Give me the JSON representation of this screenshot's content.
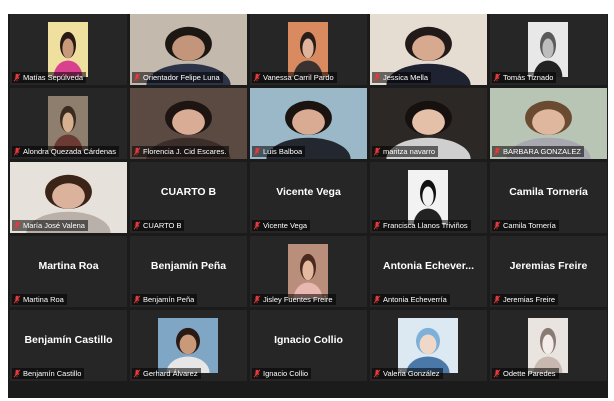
{
  "accent_active": "#d7e04a",
  "mic_muted_color": "#e5393a",
  "tiles": [
    {
      "label": "Matías Sepúlveda",
      "center": "",
      "video": "box",
      "bg": "#efe0a0",
      "skin": "#c99a7a",
      "hair": "#2a1a15",
      "shirt": "#d9418e",
      "active": false
    },
    {
      "label": "Orientador Felipe Luna",
      "center": "",
      "video": "full",
      "bg": "#c4b9ad",
      "skin": "#c3957a",
      "hair": "#1d1714",
      "shirt": "#2e3447",
      "active": false
    },
    {
      "label": "Vanessa Carril Pardo",
      "center": "",
      "video": "box",
      "bg": "#d98a5e",
      "skin": "#e0b49a",
      "hair": "#2a1c18",
      "shirt": "#3a3230",
      "active": false
    },
    {
      "label": "Jessica Mella",
      "center": "",
      "video": "full",
      "bg": "#e6ddd2",
      "skin": "#d7a98f",
      "hair": "#221a18",
      "shirt": "#1f2230",
      "active": true
    },
    {
      "label": "Tomás Tiznado",
      "center": "",
      "video": "box",
      "bg": "#e8e8e8",
      "skin": "#bdbdbd",
      "hair": "#5a5a5a",
      "shirt": "#222222",
      "active": false
    },
    {
      "label": "Alondra Quezada Cárdenas",
      "center": "",
      "video": "box",
      "bg": "#8e7e6d",
      "skin": "#d7b08f",
      "hair": "#3a2a20",
      "shirt": "#6b3a32",
      "active": false
    },
    {
      "label": "Florencia J. Cid Escares.",
      "center": "",
      "video": "full",
      "bg": "#5a4a42",
      "skin": "#d9ad95",
      "hair": "#1e1512",
      "shirt": "#3b2e2a",
      "active": false
    },
    {
      "label": "Luis Balboa",
      "center": "",
      "video": "full",
      "bg": "#9ab8c8",
      "skin": "#d8ab92",
      "hair": "#1a1310",
      "shirt": "#23272f",
      "active": false
    },
    {
      "label": "maritza navarro",
      "center": "",
      "video": "full",
      "bg": "#2c2826",
      "skin": "#e4c0a8",
      "hair": "#16110f",
      "shirt": "#cfcfcf",
      "active": false
    },
    {
      "label": "BARBARA GONZALEZ",
      "center": "",
      "video": "full",
      "bg": "#b8c4b4",
      "skin": "#dfb79e",
      "hair": "#6a4a30",
      "shirt": "#a8a8b0",
      "active": false
    },
    {
      "label": "María José Valena",
      "center": "",
      "video": "full",
      "bg": "#e7e1dc",
      "skin": "#dbb39d",
      "hair": "#3a2418",
      "shirt": "#b9b0aa",
      "active": false
    },
    {
      "label": "CUARTO B",
      "center": "CUARTO B",
      "video": "none",
      "active": false
    },
    {
      "label": "Vicente Vega",
      "center": "Vicente Vega",
      "video": "none",
      "active": false
    },
    {
      "label": "Francisca Llanos Triviños",
      "center": "",
      "video": "box",
      "bg": "#f2f2f2",
      "skin": "#f2f2f2",
      "hair": "#111111",
      "shirt": "#222222",
      "active": false
    },
    {
      "label": "Camila Tornería",
      "center": "Camila Tornería",
      "video": "none",
      "active": false
    },
    {
      "label": "Martina Roa",
      "center": "Martina Roa",
      "video": "none",
      "active": false
    },
    {
      "label": "Benjamín Peña",
      "center": "Benjamín Peña",
      "video": "none",
      "active": false
    },
    {
      "label": "Jisley Fuentes Freire",
      "center": "",
      "video": "box",
      "bg": "#b98e7a",
      "skin": "#e3b9a0",
      "hair": "#4a2a1e",
      "shirt": "#e8b7b0",
      "active": false
    },
    {
      "label": "Antonia Echeverría",
      "center": "Antonia  Echever...",
      "video": "none",
      "active": false
    },
    {
      "label": "Jeremias Freire",
      "center": "Jeremias Freire",
      "video": "none",
      "active": false
    },
    {
      "label": "Benjamín Castillo",
      "center": "Benjamín Castillo",
      "video": "none",
      "active": false
    },
    {
      "label": "Gerhard Álvarez",
      "center": "",
      "video": "box wide",
      "bg": "#7fa6c4",
      "skin": "#c99a7a",
      "hair": "#2a1a15",
      "shirt": "#e6e6e6",
      "active": false
    },
    {
      "label": "Ignacio Collio",
      "center": "Ignacio Collio",
      "video": "none",
      "active": false
    },
    {
      "label": "Valeria González",
      "center": "",
      "video": "box wide",
      "bg": "#dce9f2",
      "skin": "#f0d8c8",
      "hair": "#7fb0d8",
      "shirt": "#4a78a8",
      "active": false
    },
    {
      "label": "Odette Paredes",
      "center": "",
      "video": "box",
      "bg": "#e9e4e0",
      "skin": "#f3ece8",
      "hair": "#8a7a74",
      "shirt": "#c9b8b0",
      "active": false
    }
  ]
}
